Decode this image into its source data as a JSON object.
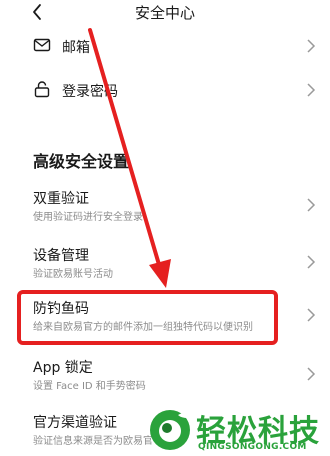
{
  "header": {
    "title": "安全中心",
    "back_icon": "back-chevron-icon"
  },
  "rows": {
    "email": {
      "label": "邮箱",
      "icon": "mail-icon"
    },
    "password": {
      "label": "登录密码",
      "icon": "lock-icon"
    }
  },
  "section": {
    "title": "高级安全设置"
  },
  "items": [
    {
      "title": "双重验证",
      "subtitle": "使用验证码进行安全登录"
    },
    {
      "title": "设备管理",
      "subtitle": "验证欧易账号活动"
    },
    {
      "title": "防钓鱼码",
      "subtitle": "给来自欧易官方的邮件添加一组独特代码以便识别"
    },
    {
      "title": "App 锁定",
      "subtitle": "设置 Face ID 和手势密码"
    },
    {
      "title": "官方渠道验证",
      "subtitle": "验证信息来源是否为欧易官"
    }
  ],
  "watermark": {
    "text_cn": "轻松科技",
    "text_en": "QINGSONGONG.COM"
  },
  "colors": {
    "highlight": "#e52020",
    "watermark": "#2aa23b",
    "subtitle": "#8c8c8c"
  }
}
